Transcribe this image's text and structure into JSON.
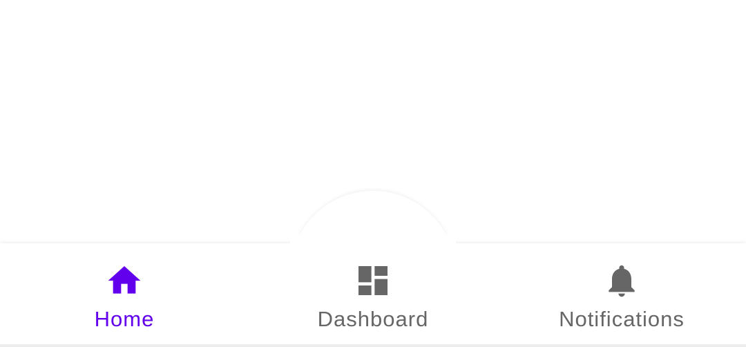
{
  "colors": {
    "active": "#6200ee",
    "inactive": "#666666",
    "background": "#ffffff"
  },
  "bottom_nav": {
    "items": [
      {
        "label": "Home",
        "icon": "home-icon",
        "active": true
      },
      {
        "label": "Dashboard",
        "icon": "dashboard-icon",
        "active": false
      },
      {
        "label": "Notifications",
        "icon": "bell-icon",
        "active": false
      }
    ]
  }
}
